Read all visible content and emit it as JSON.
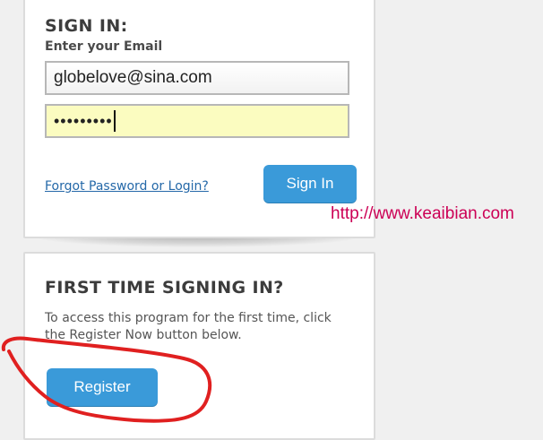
{
  "signin": {
    "heading": "SIGN IN:",
    "email_label": "Enter your Email",
    "email_value": "globelove@sina.com",
    "password_masked": "•••••••••",
    "forgot_link": "Forgot Password or Login?",
    "signin_button": "Sign In"
  },
  "first_time": {
    "heading": "FIRST TIME SIGNING IN?",
    "description": "To access this program for the first time, click the Register Now button below.",
    "register_button": "Register"
  },
  "watermark": "http://www.keaibian.com",
  "colors": {
    "accent": "#3a9ad9",
    "link": "#2468a8",
    "password_fill": "#fbfcc0",
    "annotation": "#e02020",
    "watermark": "#cc0055"
  }
}
